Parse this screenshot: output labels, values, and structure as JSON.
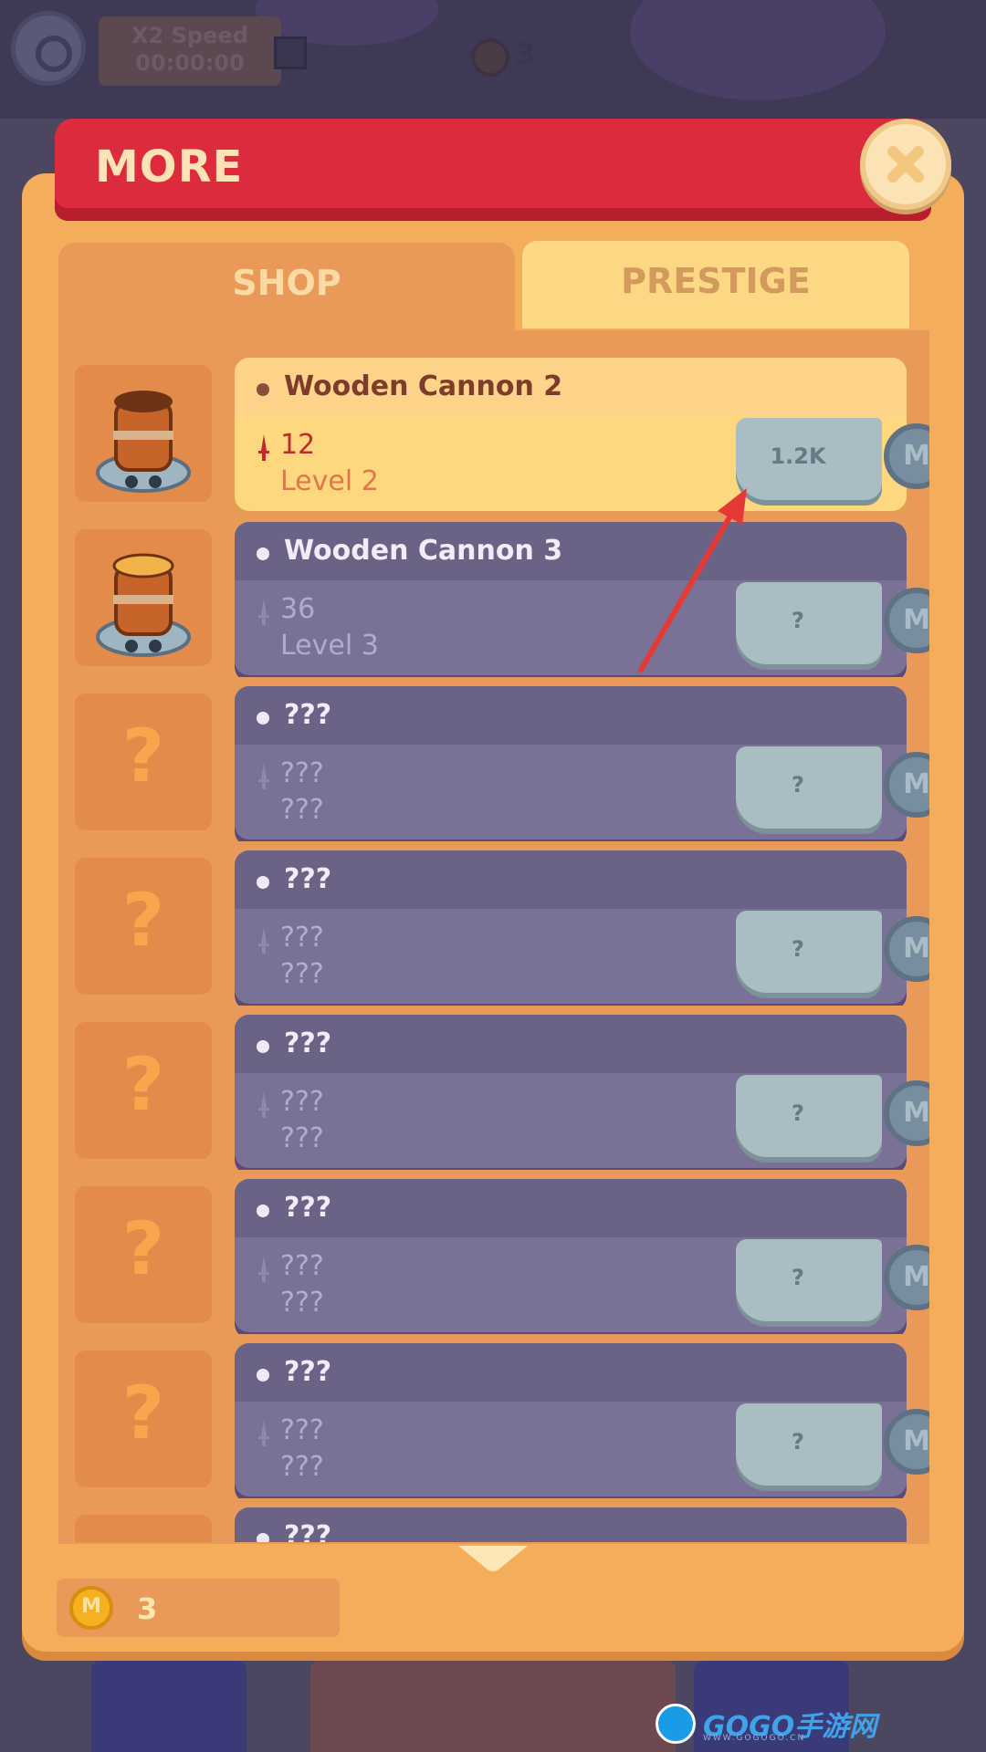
{
  "hud": {
    "speed_label": "X2 Speed",
    "speed_timer": "00:00:00",
    "coin_count": "3"
  },
  "modal": {
    "title": "MORE",
    "tabs": [
      {
        "label": "SHOP",
        "active": true
      },
      {
        "label": "PRESTIGE",
        "active": false
      }
    ]
  },
  "items": [
    {
      "name": "Wooden Cannon 2",
      "stat": "12",
      "level": "Level 2",
      "price": "1.2K",
      "state": "active",
      "icon": "wooden-cannon-2"
    },
    {
      "name": "Wooden Cannon 3",
      "stat": "36",
      "level": "Level 3",
      "price": "?",
      "state": "locked",
      "icon": "wooden-cannon-3"
    },
    {
      "name": "???",
      "stat": "???",
      "level": "???",
      "price": "?",
      "state": "unknown",
      "icon": "question-mark"
    },
    {
      "name": "???",
      "stat": "???",
      "level": "???",
      "price": "?",
      "state": "unknown",
      "icon": "question-mark"
    },
    {
      "name": "???",
      "stat": "???",
      "level": "???",
      "price": "?",
      "state": "unknown",
      "icon": "question-mark"
    },
    {
      "name": "???",
      "stat": "???",
      "level": "???",
      "price": "?",
      "state": "unknown",
      "icon": "question-mark"
    },
    {
      "name": "???",
      "stat": "???",
      "level": "???",
      "price": "?",
      "state": "unknown",
      "icon": "question-mark"
    },
    {
      "name": "???",
      "stat": "",
      "level": "",
      "price": "",
      "state": "unknown",
      "icon": "question-mark"
    }
  ],
  "currency": {
    "coin_symbol": "M",
    "balance": "3"
  },
  "question_glyph": "?",
  "watermark": {
    "brand": "GOGO手游网",
    "url": "WWW.GOGOGO.CN"
  },
  "colors": {
    "header_red": "#dc2b3c",
    "panel_orange": "#f3ad5b",
    "active_card": "#fed87f",
    "locked_card": "#7a7296",
    "arrow_red": "#e53935"
  }
}
